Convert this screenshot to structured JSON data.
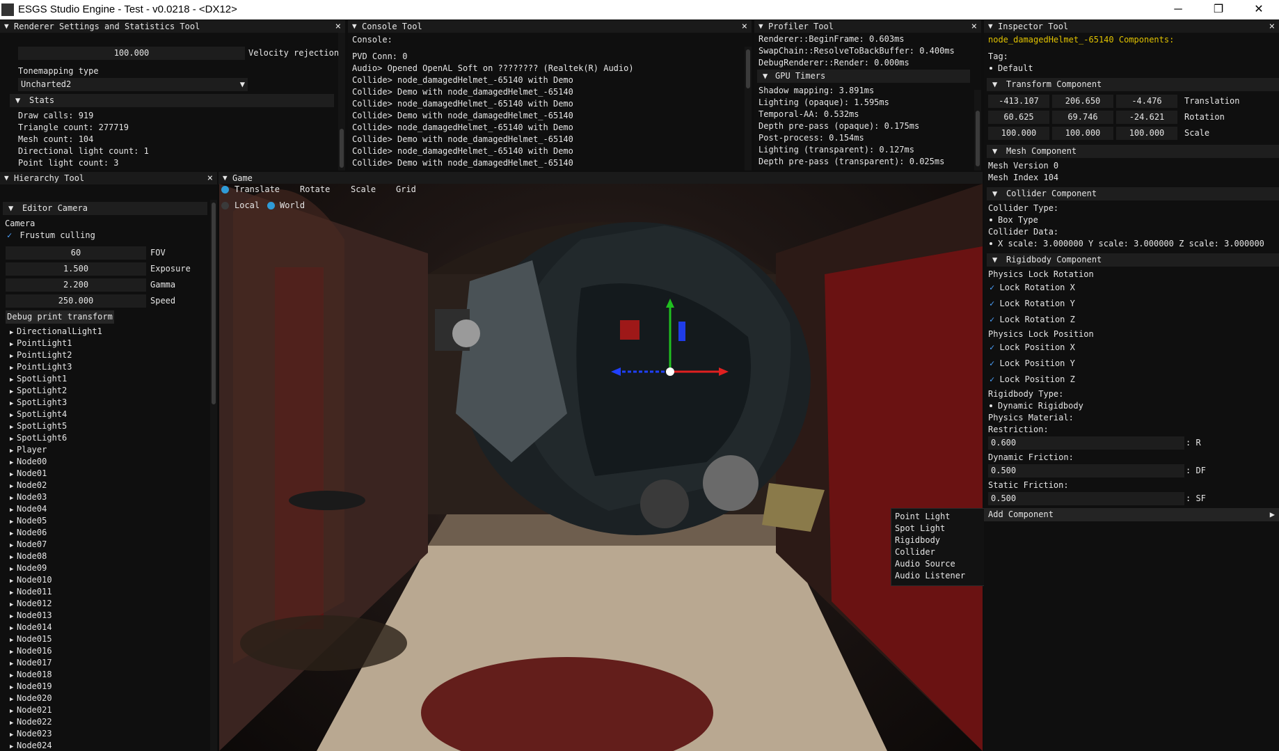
{
  "window": {
    "title": "ESGS Studio Engine - Test - v0.0218 - <DX12>",
    "minimize": "─",
    "restore": "❐",
    "close": "✕"
  },
  "renderer": {
    "title": "Renderer Settings and Statistics Tool",
    "velocity_value": "100.000",
    "velocity_label": "Velocity rejection",
    "tonemapping_label": "Tonemapping type",
    "tonemapping_value": "Uncharted2",
    "stats_header": "Stats",
    "stats": [
      "Draw calls: 919",
      "Triangle count: 277719",
      "Mesh count: 104",
      "Directional light count: 1",
      "Point light count: 3"
    ]
  },
  "console": {
    "title": "Console Tool",
    "heading": "Console:",
    "lines": [
      "PVD Conn: 0",
      "Audio> Opened OpenAL Soft on ???????? (Realtek(R) Audio)",
      "Collide> node_damagedHelmet_-65140 with Demo",
      "Collide> Demo with node_damagedHelmet_-65140",
      "Collide> node_damagedHelmet_-65140 with Demo",
      "Collide> Demo with node_damagedHelmet_-65140",
      "Collide> node_damagedHelmet_-65140 with Demo",
      "Collide> Demo with node_damagedHelmet_-65140",
      "Collide> node_damagedHelmet_-65140 with Demo",
      "Collide> Demo with node_damagedHelmet_-65140"
    ]
  },
  "profiler": {
    "title": "Profiler Tool",
    "cpu": [
      "Renderer::BeginFrame: 0.603ms",
      "SwapChain::ResolveToBackBuffer: 0.400ms",
      "DebugRenderer::Render: 0.000ms"
    ],
    "gpu_header": "GPU Timers",
    "gpu": [
      "Shadow mapping: 3.891ms",
      "Lighting (opaque): 1.595ms",
      "Temporal-AA: 0.532ms",
      "Depth pre-pass (opaque): 0.175ms",
      "Post-process: 0.154ms",
      "Lighting (transparent): 0.127ms",
      "Depth pre-pass (transparent): 0.025ms"
    ]
  },
  "hierarchy": {
    "title": "Hierarchy Tool",
    "camera_header": "Editor Camera",
    "camera_label": "Camera",
    "frustum_label": "Frustum culling",
    "params": [
      {
        "value": "60",
        "label": "FOV"
      },
      {
        "value": "1.500",
        "label": "Exposure"
      },
      {
        "value": "2.200",
        "label": "Gamma"
      },
      {
        "value": "250.000",
        "label": "Speed"
      }
    ],
    "debug_button": "Debug print transform",
    "items": [
      "DirectionalLight1",
      "PointLight1",
      "PointLight2",
      "PointLight3",
      "SpotLight1",
      "SpotLight2",
      "SpotLight3",
      "SpotLight4",
      "SpotLight5",
      "SpotLight6",
      "Player",
      "Node00",
      "Node01",
      "Node02",
      "Node03",
      "Node04",
      "Node05",
      "Node06",
      "Node07",
      "Node08",
      "Node09",
      "Node010",
      "Node011",
      "Node012",
      "Node013",
      "Node014",
      "Node015",
      "Node016",
      "Node017",
      "Node018",
      "Node019",
      "Node020",
      "Node021",
      "Node022",
      "Node023",
      "Node024"
    ]
  },
  "game": {
    "title": "Game",
    "modes": [
      "Translate",
      "Rotate",
      "Scale",
      "Grid"
    ],
    "spaces": [
      "Local",
      "World"
    ],
    "selected_mode": "Translate",
    "selected_space": "World"
  },
  "context_menu": [
    "Point Light",
    "Spot Light",
    "Rigidbody",
    "Collider",
    "Audio Source",
    "Audio Listener"
  ],
  "inspector": {
    "title": "Inspector Tool",
    "node": "node_damagedHelmet_-65140 Components:",
    "tag_label": "Tag:",
    "tag_value": "Default",
    "transform_header": "Transform Component",
    "translation": {
      "values": [
        "-413.107",
        "206.650",
        "-4.476"
      ],
      "label": "Translation"
    },
    "rotation": {
      "values": [
        "60.625",
        "69.746",
        "-24.621"
      ],
      "label": "Rotation"
    },
    "scale": {
      "values": [
        "100.000",
        "100.000",
        "100.000"
      ],
      "label": "Scale"
    },
    "mesh_header": "Mesh Component",
    "mesh_version": "Mesh Version 0",
    "mesh_index": "Mesh Index 104",
    "collider_header": "Collider Component",
    "collider_type_label": "Collider Type:",
    "collider_type": "Box Type",
    "collider_data_label": "Collider Data:",
    "collider_data": "X scale: 3.000000   Y scale: 3.000000   Z scale: 3.000000",
    "rigidbody_header": "Rigidbody Component",
    "lock_rotation_label": "Physics Lock Rotation",
    "lock_rotation": [
      "Lock Rotation X",
      "Lock Rotation Y",
      "Lock Rotation Z"
    ],
    "lock_position_label": "Physics Lock Position",
    "lock_position": [
      "Lock Position X",
      "Lock Position Y",
      "Lock Position Z"
    ],
    "rb_type_label": "Rigidbody Type:",
    "rb_type": "Dynamic Rigidbody",
    "material_label": "Physics Material:",
    "restriction_label": "Restriction:",
    "restriction": {
      "value": "0.600",
      "suffix": ": R"
    },
    "dyn_friction_label": "Dynamic Friction:",
    "dyn_friction": {
      "value": "0.500",
      "suffix": ": DF"
    },
    "static_friction_label": "Static Friction:",
    "static_friction": {
      "value": "0.500",
      "suffix": ": SF"
    },
    "add_component": "Add Component"
  },
  "colors": {
    "accent": "#2f9bd7",
    "node_name": "#e0c200",
    "gizmo_x": "#e02020",
    "gizmo_y": "#20c020",
    "gizmo_z": "#2040ff"
  }
}
